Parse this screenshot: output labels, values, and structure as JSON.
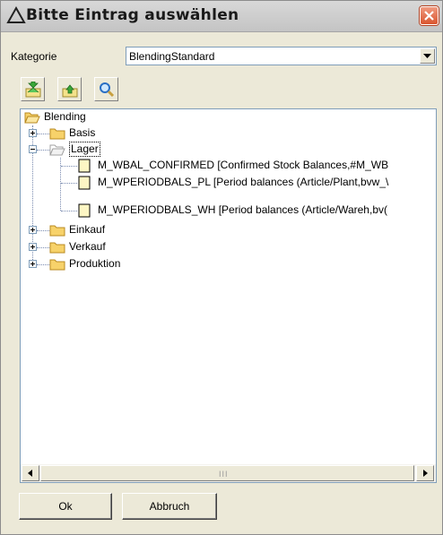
{
  "window": {
    "title": "Bitte Eintrag auswählen"
  },
  "kategorie": {
    "label": "Kategorie",
    "value": "BlendingStandard"
  },
  "toolbar": {
    "icons": [
      "import-icon",
      "export-icon",
      "search-icon"
    ]
  },
  "tree": {
    "root": "Blending",
    "nodes": [
      {
        "label": "Basis"
      },
      {
        "label": "Lager",
        "selected": true,
        "expanded": true,
        "children": [
          "M_WBAL_CONFIRMED [Confirmed Stock Balances,#M_WB",
          "M_WPERIODBALS_PL [Period balances (Article/Plant,bvw_\\",
          "M_WPERIODBALS_WH [Period balances (Article/Wareh,bv("
        ]
      },
      {
        "label": "Einkauf"
      },
      {
        "label": "Verkauf"
      },
      {
        "label": "Produktion"
      }
    ],
    "scrollbar": {
      "grip": "III"
    }
  },
  "buttons": {
    "ok": "Ok",
    "cancel": "Abbruch"
  }
}
